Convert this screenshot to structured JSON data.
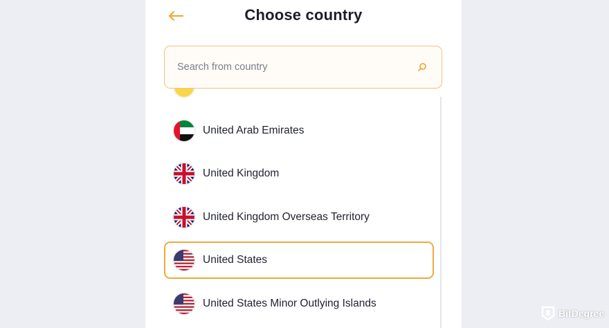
{
  "header": {
    "title": "Choose country",
    "back_icon": "arrow-left-icon",
    "accent_color": "#f0a83b"
  },
  "search": {
    "placeholder": "Search from country",
    "value": "",
    "icon": "search-icon"
  },
  "countries": [
    {
      "name": "United Arab Emirates",
      "flag": "uae-flag-icon",
      "selected": false
    },
    {
      "name": "United Kingdom",
      "flag": "uk-flag-icon",
      "selected": false
    },
    {
      "name": "United Kingdom Overseas Territory",
      "flag": "uk-flag-icon",
      "selected": false
    },
    {
      "name": "United States",
      "flag": "us-flag-icon",
      "selected": true
    },
    {
      "name": "United States Minor Outlying Islands",
      "flag": "us-flag-icon",
      "selected": false
    }
  ],
  "watermark": {
    "text": "BitDegree",
    "icon": "bitdegree-shield-icon"
  }
}
